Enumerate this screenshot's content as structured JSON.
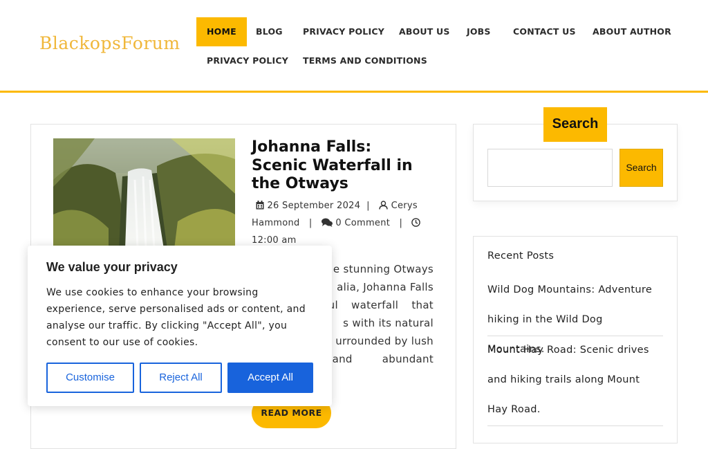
{
  "header": {
    "logo": "BlackopsForum",
    "nav": [
      {
        "label": "HOME",
        "active": true
      },
      {
        "label": "BLOG"
      },
      {
        "label": "PRIVACY POLICY"
      },
      {
        "label": "ABOUT US"
      },
      {
        "label": "JOBS"
      },
      {
        "label": "CONTACT US"
      },
      {
        "label": "ABOUT AUTHOR"
      },
      {
        "label": "PRIVACY POLICY"
      },
      {
        "label": "TERMS AND CONDITIONS"
      }
    ]
  },
  "post": {
    "title": "Johanna Falls: Scenic Waterfall in the Otways",
    "date": "26 September 2024",
    "author_part1": "Cerys",
    "author_part2": "Hammond",
    "comments": "0 Comment",
    "time": "12:00 am",
    "excerpt_lines": [
      "e stunning Otways",
      "alia, Johanna Falls",
      "ul waterfall that",
      "s with its natural",
      "urrounded by lush",
      "and abundant"
    ],
    "read_more": "READ MORE"
  },
  "sidebar": {
    "search_heading": "Search",
    "search_button": "Search",
    "search_value": "",
    "recent_heading": "Recent Posts",
    "recent_posts": [
      "Wild Dog Mountains: Adventure hiking in the Wild Dog Mountains.",
      "Mount Hay Road: Scenic drives and hiking trails along Mount Hay Road."
    ]
  },
  "cookie": {
    "title": "We value your privacy",
    "text": "We use cookies to enhance your browsing experience, serve personalised ads or content, and analyse our traffic. By clicking \"Accept All\", you consent to our use of cookies.",
    "customise": "Customise",
    "reject": "Reject All",
    "accept": "Accept All"
  },
  "colors": {
    "accent": "#fcb900",
    "logo": "#f0b73a",
    "cookie_blue": "#1863dc"
  },
  "icons": [
    "calendar-icon",
    "user-icon",
    "comments-icon",
    "clock-icon"
  ]
}
